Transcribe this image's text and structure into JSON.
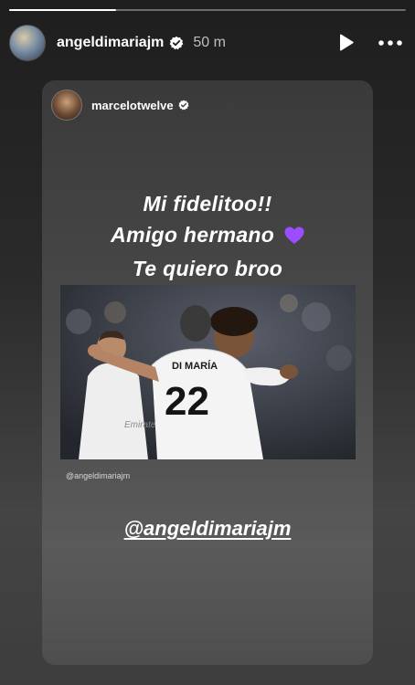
{
  "progress": {
    "fraction": 0.27
  },
  "header": {
    "username": "angeldimariajm",
    "time": "50 m",
    "avatar_icon": "profile-avatar",
    "verified_icon": "verified-badge",
    "play_icon": "play-icon",
    "more_icon": "more-dots-icon"
  },
  "shared_post": {
    "username": "marcelotwelve",
    "message_line1": "Mi fidelitoo!!",
    "message_line2": "Amigo hermano",
    "message_line3": "Te quiero broo",
    "heart_emoji": "purple-heart",
    "photo_jersey_name": "DI MARÍA",
    "photo_jersey_number": "22",
    "photo_sponsor": "Emirates",
    "photo_credit": "@angeldimariajm",
    "mention": "@angeldimariajm"
  },
  "colors": {
    "background": "#1f1f1f",
    "accent_heart": "#9b4dff",
    "text": "#ffffff"
  }
}
